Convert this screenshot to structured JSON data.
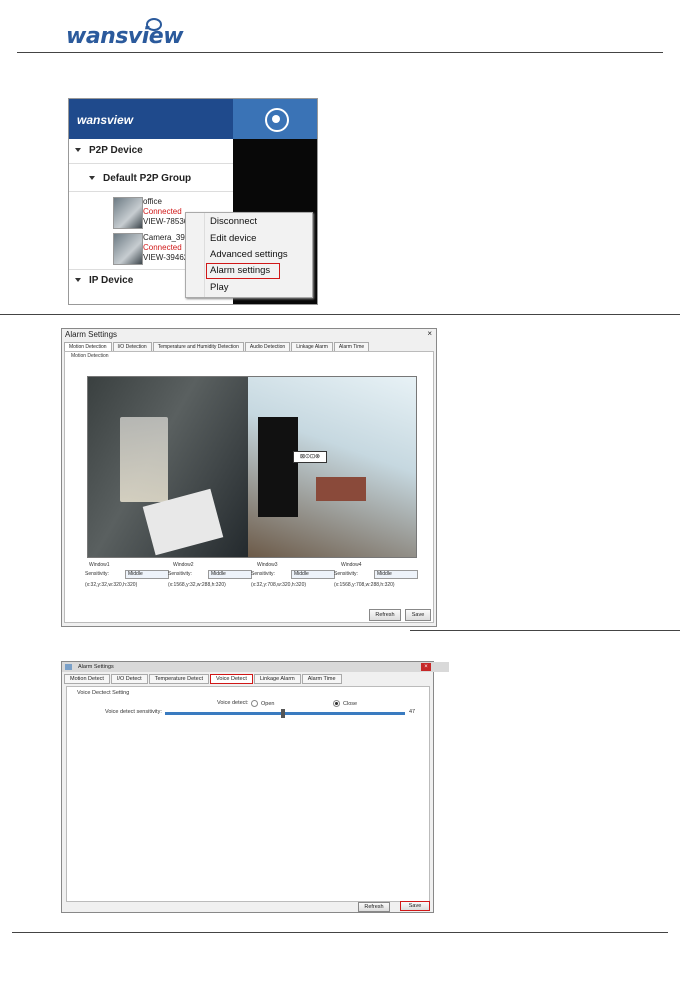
{
  "brand": {
    "logo_text": "wansview"
  },
  "screen1": {
    "header_logo": "wansview",
    "tree": {
      "p2p_device": "P2P Device",
      "default_group": "Default P2P Group",
      "ip_device": "IP Device",
      "devices": [
        {
          "name": "office",
          "status": "Connected",
          "id": "VIEW-785362-"
        },
        {
          "name": "Camera_394",
          "status": "Connected",
          "id": "VIEW-394626-"
        }
      ]
    },
    "context_menu": [
      "Disconnect",
      "Edit device",
      "Advanced settings",
      "Alarm settings",
      "Play"
    ],
    "highlighted_item": "Alarm settings"
  },
  "screen2": {
    "title": "Alarm Settings",
    "close": "×",
    "tabs": [
      "Motion Detection",
      "I/O Detection",
      "Temperature and Humidity Detection",
      "Audio Detection",
      "Linkage Alarm",
      "Alarm Time"
    ],
    "group_label": "Motion Detection",
    "overlay_icons": "⊠⊙⊡⊗",
    "windows": [
      {
        "label": "Window1",
        "sens_label": "Sensitivity:",
        "value": "Middle",
        "coords": "(x:32,y:32,w:320,h:320)"
      },
      {
        "label": "Window2",
        "sens_label": "Sensitivity:",
        "value": "Middle",
        "coords": "(x:1568,y:32,w:288,h:320)"
      },
      {
        "label": "Window3",
        "sens_label": "Sensitivity:",
        "value": "Middle",
        "coords": "(x:32,y:708,w:320,h:320)"
      },
      {
        "label": "Window4",
        "sens_label": "Sensitivity:",
        "value": "Middle",
        "coords": "(x:1568,y:708,w:288,h:320)"
      }
    ],
    "refresh": "Refresh",
    "save": "Save"
  },
  "screen3": {
    "title": "Alarm Settings",
    "tabs": [
      "Motion Detect",
      "I/O Detect",
      "Temperature Detect",
      "Voice Detect",
      "Linkage Alarm",
      "Alarm Time"
    ],
    "highlighted_tab": "Voice Detect",
    "group_label": "Voice Dectect Setting",
    "voice_detect_label": "Voice detect:",
    "open_label": "Open",
    "close_label": "Close",
    "selected_option": "Close",
    "sensitivity_label": "Voice detect sensitivity:",
    "sensitivity_value": "47",
    "refresh": "Refresh",
    "save": "Save"
  }
}
